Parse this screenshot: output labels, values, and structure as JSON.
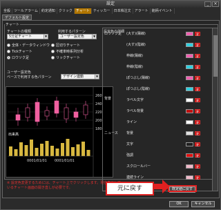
{
  "window": {
    "title": "設定"
  },
  "menu_tabs": [
    "全般",
    "ツールアラーム",
    "約定通知",
    "クリック",
    "チャート",
    "ティッカー",
    "日本株注文",
    "アラート",
    "銘柄イベント"
  ],
  "active_menu_tab": "チャート",
  "sub_tabs": [
    "デフォルト設定"
  ],
  "groups": {
    "chart_label": "チャート",
    "chart_type_label": "チャートの種類",
    "chart_type_value": "5分足チャート",
    "pattern_label": "利用するパターン",
    "pattern_value": "ユーザー設定色",
    "user_settings_label": "ユーザー設定色",
    "base_pattern_label": "ベースで利用する色パターン",
    "base_pattern_value": "デザイン連動",
    "details_label": "設定色の詳細"
  },
  "radios": [
    {
      "label": "全体・データウィンドウ",
      "on": false
    },
    {
      "label": "区切りチャート",
      "on": false
    },
    {
      "label": "Tickチャート",
      "on": false
    },
    {
      "label": "不確率時系列分析",
      "on": false
    },
    {
      "label": "ロウソク足",
      "on": true
    },
    {
      "label": "リックチャート",
      "on": false
    }
  ],
  "chart": {
    "y_ticks": [
      "260",
      "240",
      "220",
      "200",
      "180"
    ],
    "volume_label": "出来高",
    "x_ticks": [
      "0001/01/01",
      "0001/01/01"
    ],
    "candle_color": "#f060a0"
  },
  "details": {
    "categories": [
      "ロウソク足",
      "背景",
      "ニュース"
    ],
    "rows": [
      {
        "name": "(大す)(陽線)",
        "color": "#f060b0"
      },
      {
        "name": "(大す)(陰線)",
        "color": "#30d0e0"
      },
      {
        "name": "枠線(陽線)",
        "color": "#f060b0"
      },
      {
        "name": "枠線(陰線)",
        "color": "#30d0e0"
      },
      {
        "name": "ぽつぶし(陽線)",
        "color": "#f060b0"
      },
      {
        "name": "ぽつぶし(陰線)",
        "color": "#30d0e0"
      },
      {
        "name": "ラベル文字",
        "color": "#ffffff"
      },
      {
        "name": "ラベル背景",
        "color": "#c01010"
      },
      {
        "name": "ライン",
        "color": "#ffffff"
      },
      {
        "name": "背景",
        "color": "#e0e0e0"
      },
      {
        "name": "文字",
        "color": "#202020"
      },
      {
        "name": "強調",
        "color": "#e01010"
      },
      {
        "name": "スクロールバー",
        "color": "#f0b8c8"
      },
      {
        "name": "連続ライン",
        "color": "#f0b8c8"
      }
    ],
    "button_label": "更"
  },
  "note": "※ 設定色変更するためには、チャート上でクリックします。現在表示しているチャート画面の開き直しが必要です。",
  "buttons": {
    "restore": "既定値に戻す",
    "ok": "OK",
    "cancel": "キャンセル"
  },
  "callout": "元に戻す",
  "colors": {
    "accent": "#b07500",
    "alert": "#e02020"
  }
}
